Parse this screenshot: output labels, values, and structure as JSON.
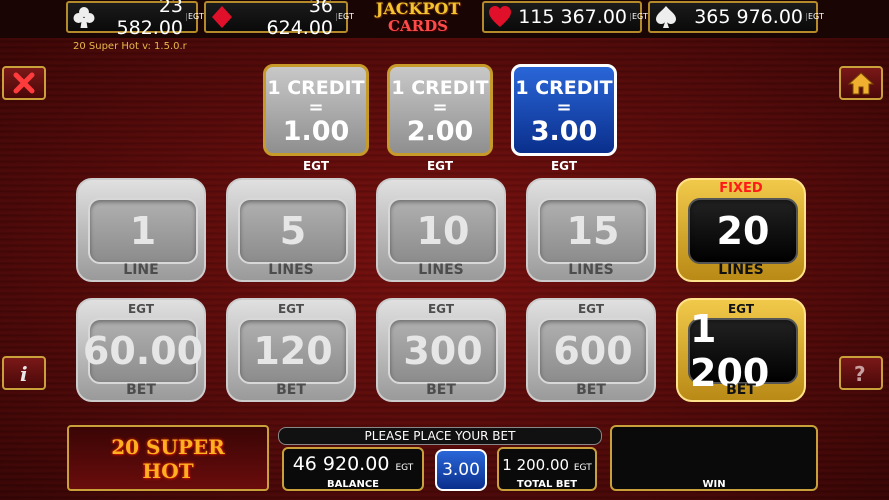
{
  "jackpots": [
    {
      "suit": "clubs-icon",
      "value": "23 582.00",
      "tag": "EGT"
    },
    {
      "suit": "diamonds-icon",
      "value": "36 624.00",
      "tag": "EGT"
    },
    {
      "suit": "hearts-icon",
      "value": "115 367.00",
      "tag": "EGT"
    },
    {
      "suit": "spades-icon",
      "value": "365 976.00",
      "tag": "EGT"
    }
  ],
  "jackpot_logo": {
    "line1": "JACKPOT",
    "line2": "CARDS"
  },
  "version": "20 Super Hot v: 1.5.0.r",
  "denominations": [
    {
      "credit": "1 CREDIT",
      "eq": "=",
      "amount": "1.00",
      "unit": "EGT",
      "active": false
    },
    {
      "credit": "1 CREDIT",
      "eq": "=",
      "amount": "2.00",
      "unit": "EGT",
      "active": false
    },
    {
      "credit": "1 CREDIT",
      "eq": "=",
      "amount": "3.00",
      "unit": "EGT",
      "active": true
    }
  ],
  "lines": [
    {
      "value": "1",
      "label": "LINE"
    },
    {
      "value": "5",
      "label": "LINES"
    },
    {
      "value": "10",
      "label": "LINES"
    },
    {
      "value": "15",
      "label": "LINES"
    },
    {
      "value": "20",
      "label": "LINES",
      "fixed": "FIXED"
    }
  ],
  "bets": [
    {
      "top": "EGT",
      "value": "60.00",
      "label": "BET"
    },
    {
      "top": "EGT",
      "value": "120",
      "label": "BET"
    },
    {
      "top": "EGT",
      "value": "300",
      "label": "BET"
    },
    {
      "top": "EGT",
      "value": "600",
      "label": "BET"
    },
    {
      "top": "EGT",
      "value": "1 200",
      "label": "BET"
    }
  ],
  "game_logo": {
    "line1": "20 SUPER",
    "line2": "HOT"
  },
  "message": "PLEASE PLACE YOUR BET",
  "balance": {
    "value": "46 920.00",
    "unit": "EGT",
    "label": "BALANCE"
  },
  "current_bet": "3.00",
  "total_bet": {
    "value": "1 200.00",
    "unit": "EGT",
    "label": "TOTAL BET"
  },
  "win": {
    "value": "",
    "label": "WIN"
  },
  "colors": {
    "accent_gold": "#c9a03a",
    "active_blue": "#1a4fc0",
    "background_red": "#5a0a0a"
  }
}
